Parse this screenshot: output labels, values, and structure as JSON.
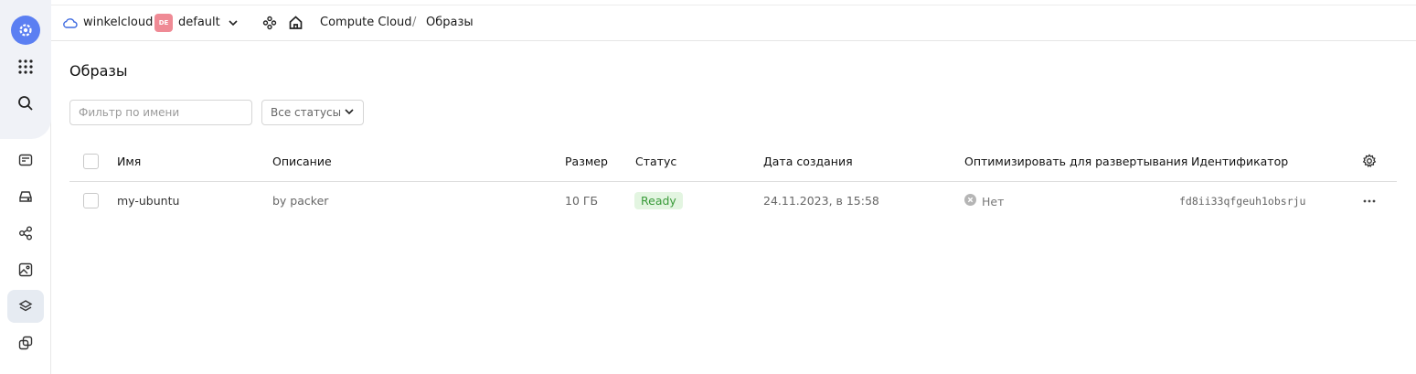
{
  "header": {
    "cloud_name": "winkelcloud",
    "org_badge": "DE",
    "folder_name": "default",
    "breadcrumb": {
      "service": "Compute Cloud",
      "separator": "/",
      "current": "Образы"
    }
  },
  "main": {
    "title": "Образы",
    "filter": {
      "placeholder": "Фильтр по имени",
      "value": ""
    },
    "status_select": {
      "value": "Все статусы"
    }
  },
  "table": {
    "columns": [
      "Имя",
      "Описание",
      "Размер",
      "Статус",
      "Дата создания",
      "Оптимизировать для развертывания",
      "Идентификатор"
    ],
    "rows": [
      {
        "name": "my-ubuntu",
        "description": "by packer",
        "size": "10 ГБ",
        "status": "Ready",
        "created": "24.11.2023, в 15:58",
        "optimize": "Нет",
        "id": "fd8ii33qfgeuh1obsrju"
      }
    ]
  },
  "colors": {
    "accent": "#5b7ff2",
    "badge": "#ef8a95",
    "ready_bg": "#e3f5e1",
    "ready_text": "#3a9b3a"
  },
  "icons": {
    "sidebar": [
      "logo-icon",
      "apps-grid-icon",
      "search-icon",
      "card-icon",
      "disk-icon",
      "share-icon",
      "image-icon",
      "layers-icon",
      "copy-icon"
    ],
    "topbar": [
      "cloud-icon",
      "chevron-down-icon",
      "services-icon",
      "home-icon"
    ],
    "table": [
      "settings-gear-icon",
      "more-icon",
      "x-circle-icon"
    ]
  }
}
